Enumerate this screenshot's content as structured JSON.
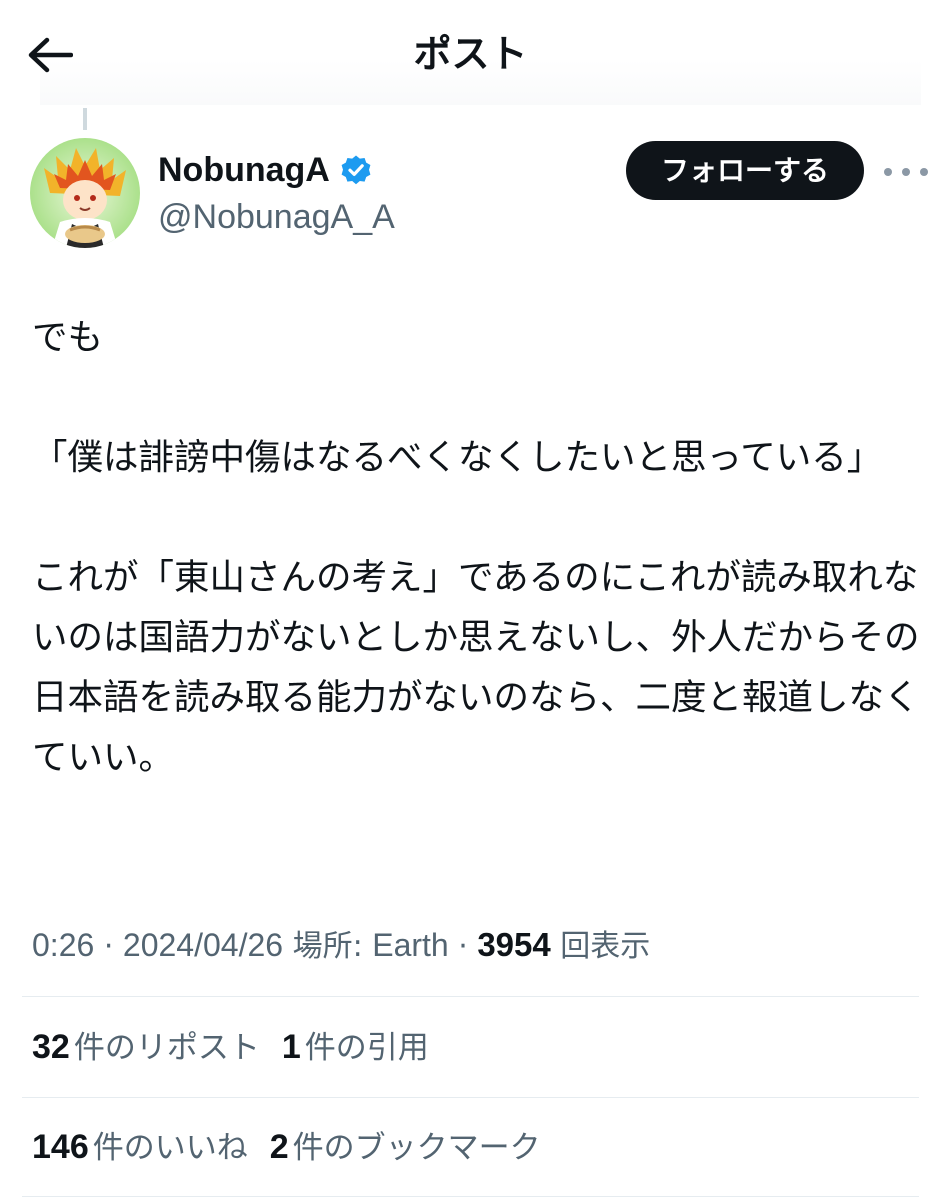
{
  "header": {
    "title": "ポスト",
    "back_icon": "arrow-left-icon"
  },
  "author": {
    "display_name": "NobunagA",
    "handle": "@NobunagA_A",
    "verified_icon": "verified-badge-icon",
    "verified_color": "#1d9bf0",
    "avatar_icon": "avatar-illustration"
  },
  "actions": {
    "follow_label": "フォローする",
    "more_icon": "more-dots-icon"
  },
  "tweet": {
    "text": "でも\n\n「僕は誹謗中傷はなるべくなくしたいと思っている」\n\nこれが「東山さんの考え」であるのにこれが読み取れないのは国語力がないとしか思えないし、外人だからその日本語を読み取る能力がないのなら、二度と報道しなくていい。"
  },
  "meta": {
    "time": "0:26",
    "separator1": " · ",
    "date": "2024/04/26",
    "location_label": " 場所: ",
    "location": "Earth",
    "separator2": " · ",
    "views_count": "3954",
    "views_label": " 回表示"
  },
  "stats": {
    "reposts_count": "32",
    "reposts_label": "件のリポスト",
    "quotes_count": "1",
    "quotes_label": "件の引用",
    "likes_count": "146",
    "likes_label": "件のいいね",
    "bookmarks_count": "2",
    "bookmarks_label": "件のブックマーク"
  }
}
